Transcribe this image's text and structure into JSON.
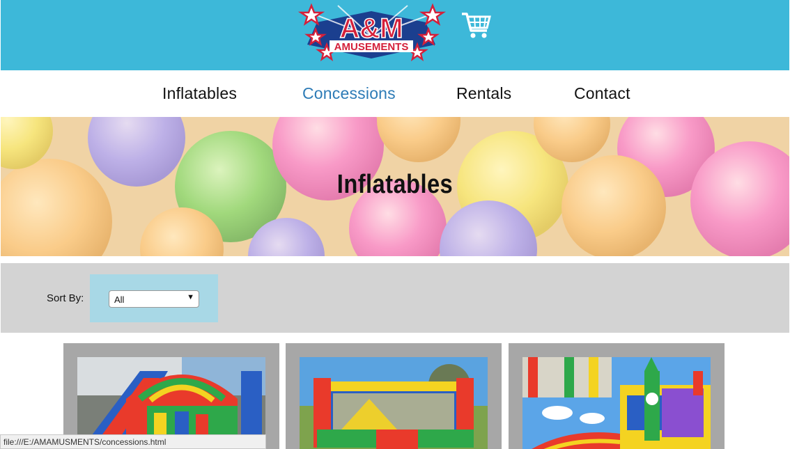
{
  "brand": {
    "logo_line1": "A&M",
    "logo_line2": "AMUSEMENTS",
    "header_color": "#3db8d9",
    "accent_color": "#2d7bb6"
  },
  "cart": {
    "icon": "shopping-cart-icon"
  },
  "nav": {
    "items": [
      {
        "label": "Inflatables",
        "active": false
      },
      {
        "label": "Concessions",
        "active": true
      },
      {
        "label": "Rentals",
        "active": false
      },
      {
        "label": "Contact",
        "active": false
      }
    ]
  },
  "hero": {
    "title": "Inflatables"
  },
  "sort": {
    "label": "Sort By:",
    "selected": "All"
  },
  "products": [
    {
      "image": "obstacle-course-inflatable-photo"
    },
    {
      "image": "bounce-house-inflatable-photo"
    },
    {
      "image": "crayon-combo-inflatable-photo"
    }
  ],
  "status": {
    "url": "file:///E:/AMAMUSMENTS/concessions.html"
  }
}
